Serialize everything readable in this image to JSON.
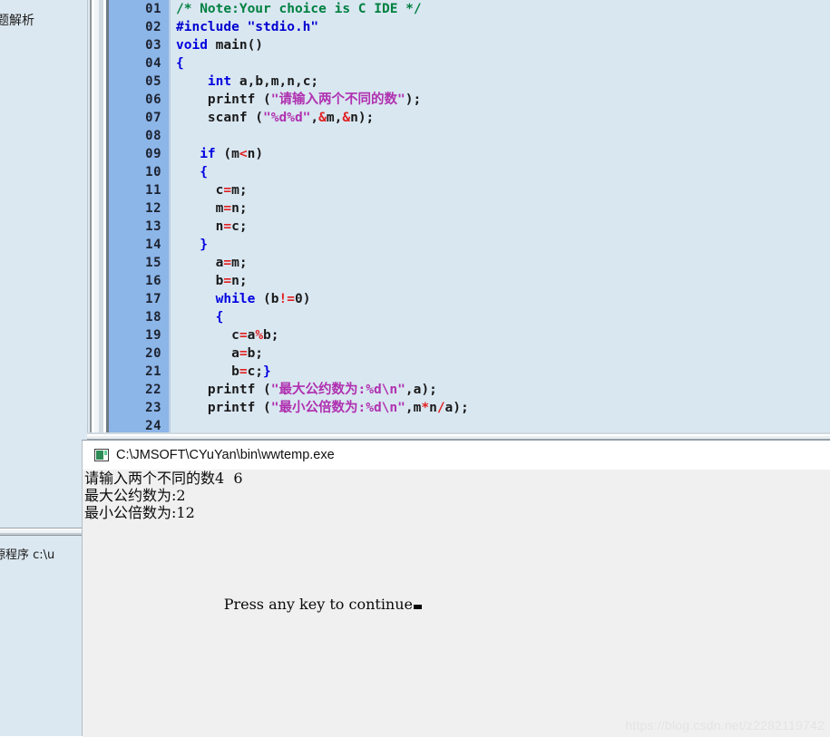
{
  "colors": {
    "editor_bg": "#d9e7f1",
    "gutter_bg": "#8cb5e8",
    "sidebar_bg": "#dce8f1",
    "console_bg": "#f0f0f0",
    "console_titlebar_bg": "#ffffff",
    "comment": "#008040",
    "keyword": "#0000e0",
    "preprocessor": "#0000d0",
    "string": "#b030b0",
    "operator": "#e02020",
    "watermark": "#e4e4e4"
  },
  "sidebar": {
    "title": "试题解析",
    "status": "源程序 c:\\u"
  },
  "editor": {
    "lines": [
      {
        "number": "01",
        "tokens": [
          {
            "text": "/* Note:Your choice is C IDE */",
            "type": "comment"
          }
        ]
      },
      {
        "number": "02",
        "tokens": [
          {
            "text": "#include ",
            "type": "preprocessor"
          },
          {
            "text": "\"stdio.h\"",
            "type": "preprocessor"
          }
        ]
      },
      {
        "number": "03",
        "tokens": [
          {
            "text": "void",
            "type": "keyword"
          },
          {
            "text": " main()",
            "type": "plain"
          }
        ]
      },
      {
        "number": "04",
        "tokens": [
          {
            "text": "{",
            "type": "brace"
          }
        ]
      },
      {
        "number": "05",
        "tokens": [
          {
            "text": "    ",
            "type": "plain"
          },
          {
            "text": "int",
            "type": "keyword"
          },
          {
            "text": " a,b,m,n,c;",
            "type": "plain"
          }
        ]
      },
      {
        "number": "06",
        "tokens": [
          {
            "text": "    printf (",
            "type": "plain"
          },
          {
            "text": "\"请输入两个不同的数\"",
            "type": "string"
          },
          {
            "text": ");",
            "type": "plain"
          }
        ]
      },
      {
        "number": "07",
        "tokens": [
          {
            "text": "    scanf (",
            "type": "plain"
          },
          {
            "text": "\"%d%d\"",
            "type": "string"
          },
          {
            "text": ",",
            "type": "plain"
          },
          {
            "text": "&",
            "type": "operator"
          },
          {
            "text": "m,",
            "type": "plain"
          },
          {
            "text": "&",
            "type": "operator"
          },
          {
            "text": "n);",
            "type": "plain"
          }
        ]
      },
      {
        "number": "08",
        "tokens": []
      },
      {
        "number": "09",
        "tokens": [
          {
            "text": "   ",
            "type": "plain"
          },
          {
            "text": "if",
            "type": "keyword"
          },
          {
            "text": " (m",
            "type": "plain"
          },
          {
            "text": "<",
            "type": "operator"
          },
          {
            "text": "n)",
            "type": "plain"
          }
        ]
      },
      {
        "number": "10",
        "tokens": [
          {
            "text": "   ",
            "type": "plain"
          },
          {
            "text": "{",
            "type": "brace"
          }
        ]
      },
      {
        "number": "11",
        "tokens": [
          {
            "text": "     c",
            "type": "plain"
          },
          {
            "text": "=",
            "type": "operator"
          },
          {
            "text": "m;",
            "type": "plain"
          }
        ]
      },
      {
        "number": "12",
        "tokens": [
          {
            "text": "     m",
            "type": "plain"
          },
          {
            "text": "=",
            "type": "operator"
          },
          {
            "text": "n;",
            "type": "plain"
          }
        ]
      },
      {
        "number": "13",
        "tokens": [
          {
            "text": "     n",
            "type": "plain"
          },
          {
            "text": "=",
            "type": "operator"
          },
          {
            "text": "c;",
            "type": "plain"
          }
        ]
      },
      {
        "number": "14",
        "tokens": [
          {
            "text": "   ",
            "type": "plain"
          },
          {
            "text": "}",
            "type": "brace"
          }
        ]
      },
      {
        "number": "15",
        "tokens": [
          {
            "text": "     a",
            "type": "plain"
          },
          {
            "text": "=",
            "type": "operator"
          },
          {
            "text": "m;",
            "type": "plain"
          }
        ]
      },
      {
        "number": "16",
        "tokens": [
          {
            "text": "     b",
            "type": "plain"
          },
          {
            "text": "=",
            "type": "operator"
          },
          {
            "text": "n;",
            "type": "plain"
          }
        ]
      },
      {
        "number": "17",
        "tokens": [
          {
            "text": "     ",
            "type": "plain"
          },
          {
            "text": "while",
            "type": "keyword"
          },
          {
            "text": " (b",
            "type": "plain"
          },
          {
            "text": "!=",
            "type": "operator"
          },
          {
            "text": "0)",
            "type": "plain"
          }
        ]
      },
      {
        "number": "18",
        "tokens": [
          {
            "text": "     ",
            "type": "plain"
          },
          {
            "text": "{",
            "type": "brace"
          }
        ]
      },
      {
        "number": "19",
        "tokens": [
          {
            "text": "       c",
            "type": "plain"
          },
          {
            "text": "=",
            "type": "operator"
          },
          {
            "text": "a",
            "type": "plain"
          },
          {
            "text": "%",
            "type": "operator"
          },
          {
            "text": "b;",
            "type": "plain"
          }
        ]
      },
      {
        "number": "20",
        "tokens": [
          {
            "text": "       a",
            "type": "plain"
          },
          {
            "text": "=",
            "type": "operator"
          },
          {
            "text": "b;",
            "type": "plain"
          }
        ]
      },
      {
        "number": "21",
        "tokens": [
          {
            "text": "       b",
            "type": "plain"
          },
          {
            "text": "=",
            "type": "operator"
          },
          {
            "text": "c;",
            "type": "plain"
          },
          {
            "text": "}",
            "type": "brace"
          }
        ]
      },
      {
        "number": "22",
        "tokens": [
          {
            "text": "    printf (",
            "type": "plain"
          },
          {
            "text": "\"最大公约数为:%d\\n\"",
            "type": "string"
          },
          {
            "text": ",a);",
            "type": "plain"
          }
        ]
      },
      {
        "number": "23",
        "tokens": [
          {
            "text": "    printf (",
            "type": "plain"
          },
          {
            "text": "\"最小公倍数为:%d\\n\"",
            "type": "string"
          },
          {
            "text": ",m",
            "type": "plain"
          },
          {
            "text": "*",
            "type": "operator"
          },
          {
            "text": "n",
            "type": "plain"
          },
          {
            "text": "/",
            "type": "operator"
          },
          {
            "text": "a);",
            "type": "plain"
          }
        ]
      },
      {
        "number": "24",
        "tokens": []
      }
    ]
  },
  "console": {
    "title": "C:\\JMSOFT\\CYuYan\\bin\\wwtemp.exe",
    "icon": "console-window-icon",
    "output_lines": [
      "请输入两个不同的数4  6",
      "最大公约数为:2",
      "最小公倍数为:12"
    ],
    "prompt": "Press any key to continue"
  },
  "watermark": {
    "text": "https://blog.csdn.net/z2282119742"
  }
}
